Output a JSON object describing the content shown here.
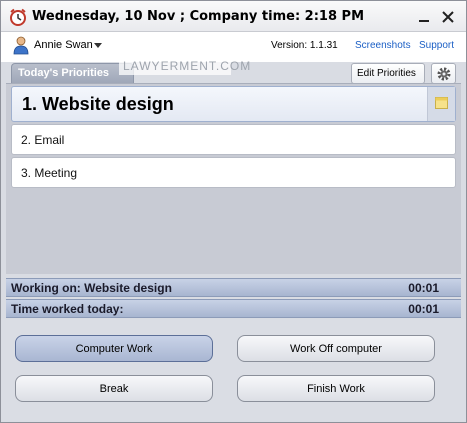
{
  "window": {
    "title": "Wednesday, 10 Nov ; Company time: 2:18 PM"
  },
  "user": {
    "name": "Annie Swan",
    "version": "Version: 1.1.31",
    "links": [
      "Screenshots",
      "Support"
    ]
  },
  "tabs": {
    "active": "Today's Priorities",
    "edit_label": "Edit Priorities"
  },
  "watermark": "LAWYERMENT.COM",
  "priorities": [
    {
      "label": "1. Website design",
      "selected": true
    },
    {
      "label": "2. Email",
      "selected": false
    },
    {
      "label": "3. Meeting",
      "selected": false
    }
  ],
  "status": {
    "working_on": "Working on: Website design",
    "working_time": "00:01",
    "worked_today": "Time worked today:",
    "today_time": "00:01"
  },
  "buttons": {
    "computer_work": "Computer Work",
    "work_off": "Work Off computer",
    "break": "Break",
    "finish": "Finish Work"
  },
  "colors": {
    "accent": "#a9b6d2",
    "link": "#1b5fc5",
    "status_bar": "#b8c3da"
  },
  "icons": {
    "app": "alarm-clock-icon",
    "user": "user-icon",
    "settings": "gear-icon",
    "note": "note-icon"
  }
}
